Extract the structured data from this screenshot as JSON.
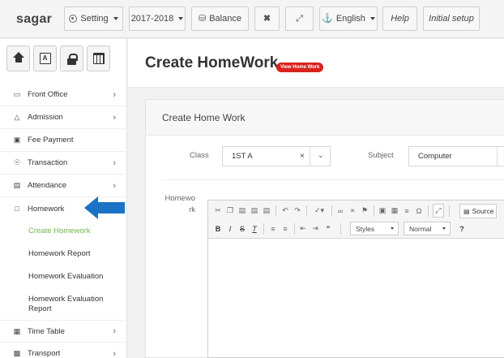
{
  "topbar": {
    "brand": "sagar",
    "setting_label": "Setting",
    "session_label": "2017-2018",
    "balance_label": "Balance",
    "language_label": "English",
    "help_label": "Help",
    "initial_setup_label": "Initial setup"
  },
  "sidebar": {
    "menu": [
      {
        "label": "Front Office",
        "icon": "monitor-icon"
      },
      {
        "label": "Admission",
        "icon": "graduation-cap-icon"
      },
      {
        "label": "Fee Payment",
        "icon": "money-icon"
      },
      {
        "label": "Transaction",
        "icon": "globe-icon"
      },
      {
        "label": "Attendance",
        "icon": "bar-chart-icon"
      },
      {
        "label": "Homework",
        "icon": "file-icon"
      }
    ],
    "submenu": [
      {
        "label": "Create Homework",
        "active": true
      },
      {
        "label": "Homework Report"
      },
      {
        "label": "Homework Evaluation"
      },
      {
        "label": "Homework Evaluation Report"
      }
    ],
    "menu_bottom": [
      {
        "label": "Time Table",
        "icon": "calendar-icon"
      },
      {
        "label": "Transport",
        "icon": "bus-icon"
      }
    ]
  },
  "page": {
    "title": "Create HomeWork",
    "view_badge": "View Home Work",
    "panel_title": "Create Home Work"
  },
  "form": {
    "class_label": "Class",
    "class_value": "1ST A",
    "subject_label": "Subject",
    "subject_value": "Computer",
    "homework_label": "Homework"
  },
  "editor": {
    "styles_label": "Styles",
    "format_label": "Normal",
    "source_label": "Source"
  },
  "colors": {
    "accent_green": "#71b54b",
    "badge_red": "#d9231d",
    "arrow_blue": "#1a73c4"
  }
}
